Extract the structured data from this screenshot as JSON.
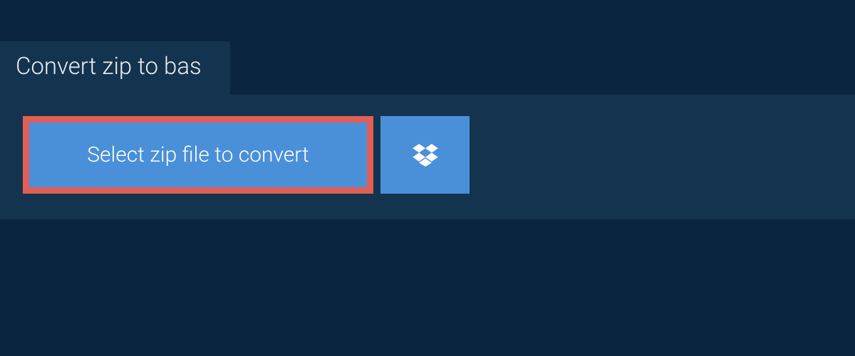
{
  "tab": {
    "title": "Convert zip to bas"
  },
  "actions": {
    "select_label": "Select zip file to convert"
  },
  "colors": {
    "page_bg": "#0a2540",
    "panel_bg": "#13334e",
    "button_bg": "#4a90d9",
    "highlight_border": "#e15f56",
    "text_light": "#ffffff"
  }
}
